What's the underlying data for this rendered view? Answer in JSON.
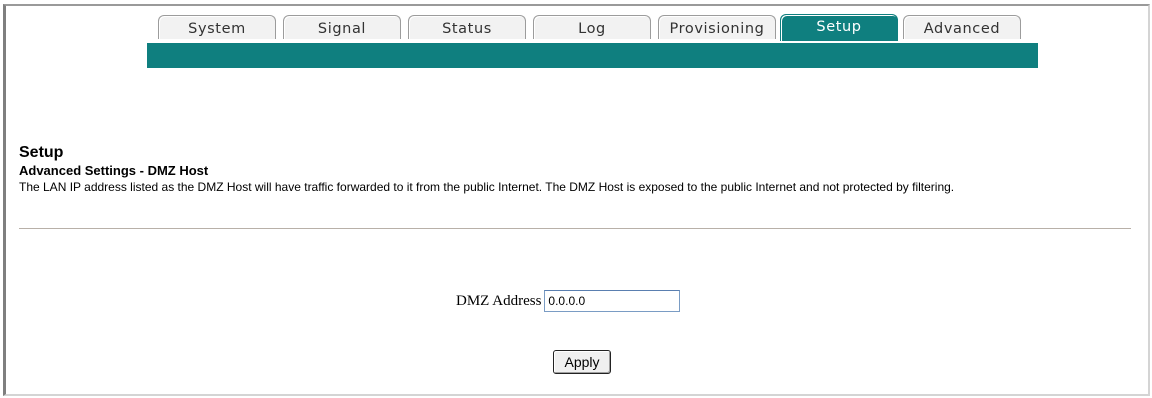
{
  "nav": {
    "tabs": [
      {
        "label": "System",
        "active": false
      },
      {
        "label": "Signal",
        "active": false
      },
      {
        "label": "Status",
        "active": false
      },
      {
        "label": "Log",
        "active": false
      },
      {
        "label": "Provisioning",
        "active": false
      },
      {
        "label": "Setup",
        "active": true
      },
      {
        "label": "Advanced",
        "active": false
      }
    ],
    "bar_color": "#0f7f7f"
  },
  "page": {
    "title": "Setup",
    "subtitle": "Advanced Settings - DMZ Host",
    "description": "The LAN IP address listed as the DMZ Host will have traffic forwarded to it from the public Internet. The DMZ Host is exposed to the public Internet and not protected by filtering."
  },
  "form": {
    "dmz_label": "DMZ Address",
    "dmz_value": "0.0.0.0",
    "apply_label": "Apply"
  }
}
